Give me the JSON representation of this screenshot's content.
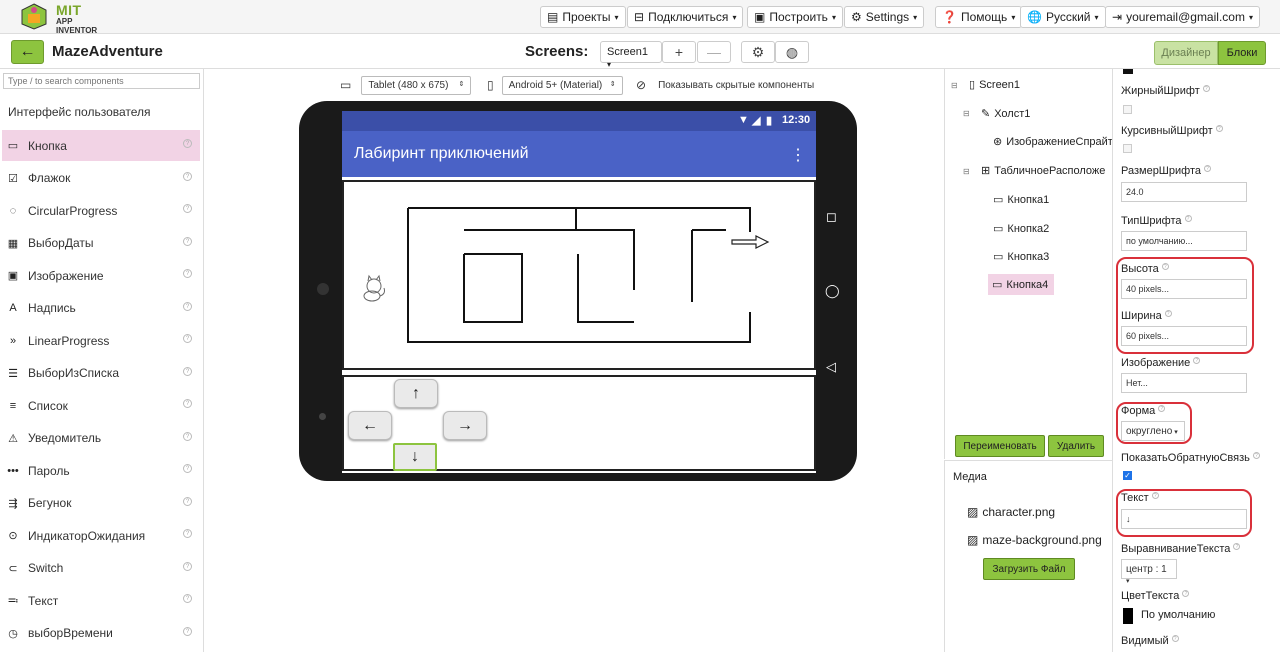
{
  "header": {
    "logo_top": "MIT",
    "logo_bottom": "APP INVENTOR",
    "menus": [
      {
        "label": "Проекты",
        "icon": "folder-icon"
      },
      {
        "label": "Подключиться",
        "icon": "plug-icon"
      },
      {
        "label": "Построить",
        "icon": "build-icon"
      },
      {
        "label": "Settings",
        "icon": "gear-icon"
      },
      {
        "label": "Помощь",
        "icon": "help-icon"
      },
      {
        "label": "Русский",
        "icon": "globe-icon"
      },
      {
        "label": "youremail@gmail.com",
        "icon": "logout-icon"
      }
    ]
  },
  "toolbar": {
    "back_label": "←",
    "project_name": "MazeAdventure",
    "screens_label": "Screens:",
    "screen_select": "Screen1",
    "add_label": "+",
    "remove_label": "—",
    "designer_label": "Дизайнер",
    "blocks_label": "Блоки"
  },
  "palette": {
    "search_placeholder": "Type / to search components",
    "category": "Интерфейс пользователя",
    "items": [
      {
        "label": "Кнопка",
        "icon": "button-icon",
        "glyph": "▭"
      },
      {
        "label": "Флажок",
        "icon": "checkbox-icon",
        "glyph": "☑"
      },
      {
        "label": "CircularProgress",
        "icon": "circular-progress-icon",
        "glyph": "◌"
      },
      {
        "label": "ВыборДаты",
        "icon": "calendar-icon",
        "glyph": "▦"
      },
      {
        "label": "Изображение",
        "icon": "image-icon",
        "glyph": "▣"
      },
      {
        "label": "Надпись",
        "icon": "label-icon",
        "glyph": "A"
      },
      {
        "label": "LinearProgress",
        "icon": "linear-progress-icon",
        "glyph": "»"
      },
      {
        "label": "ВыборИзСписка",
        "icon": "listpicker-icon",
        "glyph": "☰"
      },
      {
        "label": "Список",
        "icon": "listview-icon",
        "glyph": "≡"
      },
      {
        "label": "Уведомитель",
        "icon": "notifier-icon",
        "glyph": "⚠"
      },
      {
        "label": "Пароль",
        "icon": "password-icon",
        "glyph": "•••"
      },
      {
        "label": "Бегунок",
        "icon": "slider-icon",
        "glyph": "⇶"
      },
      {
        "label": "ИндикаторОжидания",
        "icon": "spinner-icon",
        "glyph": "⊙"
      },
      {
        "label": "Switch",
        "icon": "switch-icon",
        "glyph": "⊂"
      },
      {
        "label": "Текст",
        "icon": "textbox-icon",
        "glyph": "≕"
      },
      {
        "label": "выборВремени",
        "icon": "clock-icon",
        "glyph": "◷"
      }
    ]
  },
  "viewer": {
    "device_select": "Tablet (480 x 675)",
    "theme_select": "Android 5+ (Material)",
    "hidden_label": "Показывать скрытые компоненты",
    "status_time": "12:30",
    "app_title": "Лабиринт приключений",
    "menu_glyph": "⋮",
    "buttons": {
      "up": "↑",
      "left": "←",
      "right": "→",
      "down": "↓"
    }
  },
  "tree": {
    "items": [
      {
        "label": "Screen1"
      },
      {
        "label": "Холст1"
      },
      {
        "label": "ИзображениеСпрайт"
      },
      {
        "label": "ТабличноеРасположе"
      },
      {
        "label": "Кнопка1"
      },
      {
        "label": "Кнопка2"
      },
      {
        "label": "Кнопка3"
      },
      {
        "label": "Кнопка4"
      }
    ],
    "rename_label": "Переименовать",
    "delete_label": "Удалить"
  },
  "media": {
    "title": "Медиа",
    "files": [
      "character.png",
      "maze-background.png"
    ],
    "upload_label": "Загрузить Файл"
  },
  "properties": {
    "bold_label": "ЖирныйШрифт",
    "italic_label": "КурсивныйШрифт",
    "fontsize_label": "РазмерШрифта",
    "fontsize_value": "24.0",
    "typeface_label": "ТипШрифта",
    "typeface_value": "по умолчанию...",
    "height_label": "Высота",
    "height_value": "40 pixels...",
    "width_label": "Ширина",
    "width_value": "60 pixels...",
    "image_label": "Изображение",
    "image_value": "Нет...",
    "shape_label": "Форма",
    "shape_value": "округлено",
    "feedback_label": "ПоказатьОбратнуюСвязь",
    "text_label": "Текст",
    "text_value": "↓",
    "align_label": "ВыравниваниеТекста",
    "align_value": "центр : 1",
    "textcolor_label": "ЦветТекста",
    "textcolor_value": "По умолчанию",
    "visible_label": "Видимый"
  },
  "colors": {
    "accent_green": "#8dc43f",
    "appbar_blue": "#4a62c6",
    "selection_pink": "#f2d3e5",
    "highlight_red": "#d9303a"
  }
}
